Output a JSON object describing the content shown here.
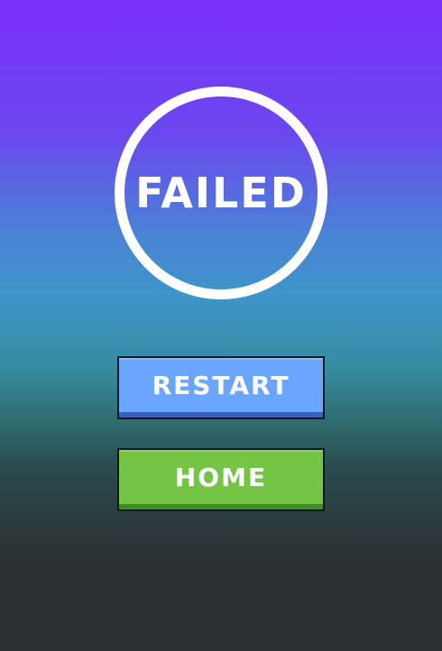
{
  "result": {
    "title": "FAILED"
  },
  "buttons": {
    "restart_label": "RESTART",
    "home_label": "HOME"
  },
  "colors": {
    "restart_button": "#6aa5ff",
    "home_button": "#74c446",
    "ring": "#ffffff"
  }
}
